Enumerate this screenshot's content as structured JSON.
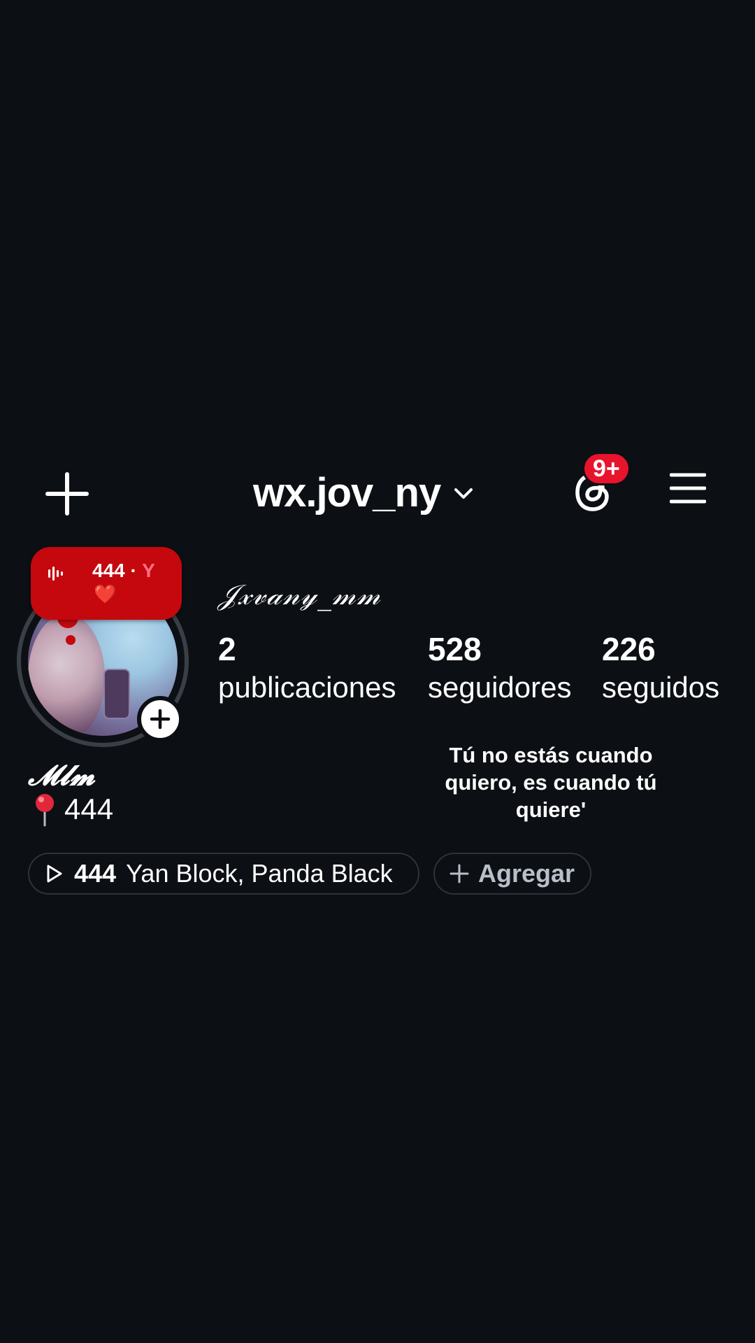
{
  "header": {
    "username": "wx.jov_ny",
    "threads_badge": "9+"
  },
  "note": {
    "count": "444",
    "separator": "·",
    "trailing": "Y",
    "emoji": "❤️"
  },
  "profile": {
    "display_name": "𝒥𝓍𝓋𝒶𝓃𝓎_𝓂𝓂",
    "stats": [
      {
        "value": "2",
        "label": "publicaciones"
      },
      {
        "value": "528",
        "label": "seguidores"
      },
      {
        "value": "226",
        "label": "seguidos"
      }
    ]
  },
  "bio": {
    "name": "𝓜𝓵𝓶",
    "location_text": "444",
    "quote": "Tú no estás cuando quiero, es cuando tú quiere'"
  },
  "chips": {
    "music_count": "444",
    "music_artists": "Yan Block, Panda Black",
    "add_label": "Agregar"
  },
  "colors": {
    "background": "#0c0f14",
    "note_red": "#c4080e",
    "badge_red": "#e8132c",
    "chip_border": "#2e3239"
  }
}
